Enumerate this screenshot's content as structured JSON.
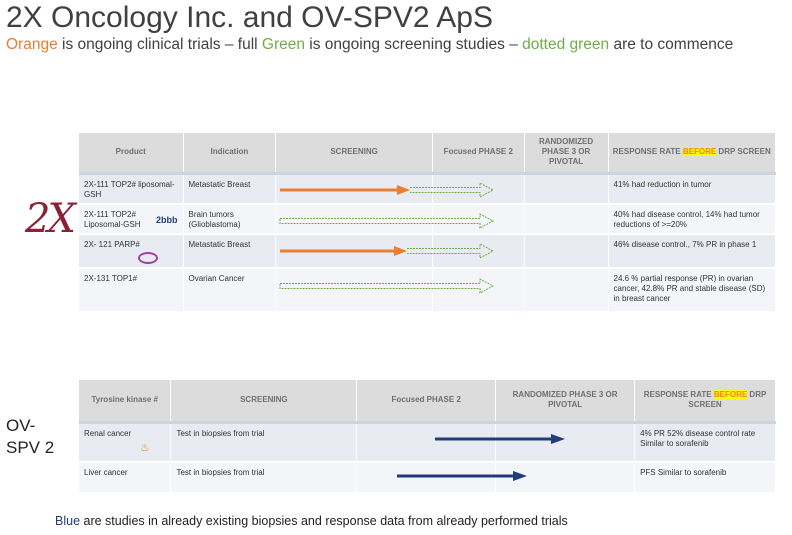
{
  "title": "2X Oncology Inc. and OV-SPV2 ApS",
  "subtitle": {
    "orange_word": "Orange",
    "part1": " is ongoing clinical trials – full ",
    "green_word": "Green",
    "part2": " is ongoing screening studies – ",
    "dotted_green": "dotted green",
    "part3": " are to commence"
  },
  "logo_2x": "2X",
  "ovspv_label": "OV-\nSPV 2",
  "table1": {
    "headers": {
      "product": "Product",
      "indication": "Indication",
      "screening": "SCREENING",
      "phase2": "Focused PHASE 2",
      "phase3": "RANDOMIZED PHASE 3 OR PIVOTAL",
      "response_pre": "RESPONSE RATE ",
      "response_hl": "BEFORE",
      "response_post": " DRP SCREEN"
    },
    "rows": [
      {
        "product": "2X-111 TOP2# liposomal-GSH",
        "indication": "Metastatic Breast",
        "response": "41% had reduction in tumor",
        "logo": ""
      },
      {
        "product": "2X-111 TOP2# Liposomal-GSH",
        "indication": "Brain tumors (Glioblastoma)",
        "response": "40% had disease control, 14% had tumor reductions of >=20%",
        "logo": "2bbb"
      },
      {
        "product": "2X- 121 PARP#",
        "indication": "Metastatic Breast",
        "response": "46% disease control., 7% PR in phase 1",
        "logo": "Eisai"
      },
      {
        "product": "2X-131 TOP1#",
        "indication": "Ovarian Cancer",
        "response": "24.6 % partial response (PR) in ovarian cancer, 42.8% PR and stable disease (SD) in breast cancer",
        "logo": ""
      }
    ]
  },
  "table2": {
    "headers": {
      "kinase": "Tyrosine kinase #",
      "screening": "SCREENING",
      "phase2": "Focused PHASE 2",
      "phase3": "RANDOMIZED PHASE 3 OR PIVOTAL",
      "response_pre": "RESPONSE RATE ",
      "response_hl": "BEFORE",
      "response_post": " DRP SCREEN"
    },
    "rows": [
      {
        "kinase": "Renal cancer",
        "screening": "Test in biopsies from trial",
        "response": "4% PR 52% disease control rate Similar to sorafenib",
        "logo": "NOVARTIS"
      },
      {
        "kinase": "Liver cancer",
        "screening": "Test in biopsies from trial",
        "response": "PFS Similar to sorafenib",
        "logo": ""
      }
    ]
  },
  "footer": {
    "blue_word": "Blue",
    "rest": " are studies in already existing biopsies and response data from already performed trials"
  },
  "colors": {
    "orange": "#ed7d31",
    "green": "#70ad47",
    "blue": "#1f3d7a",
    "highlight": "#ffff00",
    "header_bg": "#dcdcdc",
    "brand_2x": "#8b2136"
  }
}
